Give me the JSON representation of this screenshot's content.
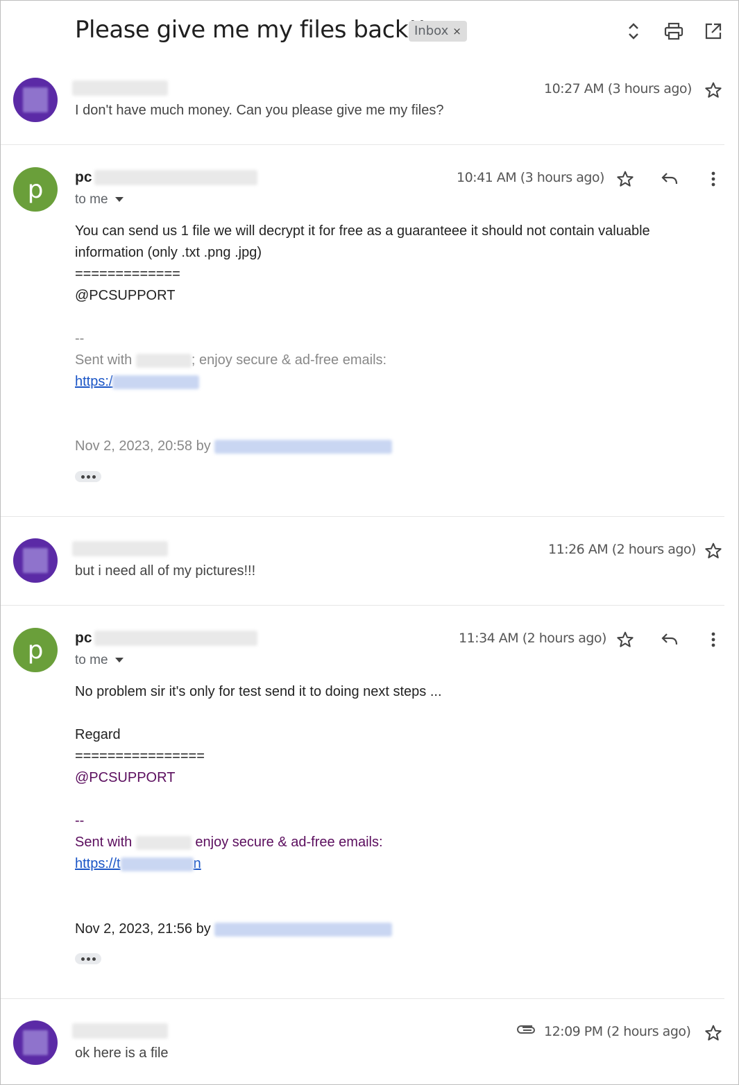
{
  "header": {
    "subject": "Please give me my files back!!",
    "label_badge": "Inbox",
    "label_close": "×"
  },
  "messages": [
    {
      "snippet": "I don't have much money. Can you please give me my files?",
      "time": "10:27 AM (3 hours ago)"
    },
    {
      "avatar_letter": "p",
      "sender_prefix": "pc",
      "recipient": "to me",
      "time": "10:41 AM (3 hours ago)",
      "body": [
        "You can send us 1 file we will decrypt it for free as a guaranteee it should not contain valuable",
        "information (only .txt .png .jpg)",
        "=============",
        "@PCSUPPORT"
      ],
      "sig_dash": "--",
      "sig_sent_with": "Sent with",
      "sig_rest": "; enjoy secure & ad-free emails:",
      "sig_link": "https:/",
      "quote_date": "Nov 2, 2023, 20:58 by"
    },
    {
      "snippet": "but i need all of my pictures!!!",
      "time": "11:26 AM (2 hours ago)"
    },
    {
      "avatar_letter": "p",
      "sender_prefix": "pc",
      "recipient": "to me",
      "time": "11:34 AM (2 hours ago)",
      "body": [
        "No problem sir it's only for test  send it to doing next steps ...",
        "Regard",
        "================",
        "@PCSUPPORT"
      ],
      "sig_dash": "--",
      "sig_sent_with": "Sent with",
      "sig_rest": " enjoy secure & ad-free emails:",
      "sig_link": "https://t",
      "sig_link_end": "n",
      "quote_date": "Nov 2, 2023, 21:56 by"
    },
    {
      "snippet": "ok here is a file",
      "time": "12:09 PM (2 hours ago)"
    }
  ],
  "colors": {
    "purple_avatar": "#5b2aa6",
    "green_avatar": "#6a9f3a",
    "link": "#1a55c6",
    "signature": "#5b0e5e"
  }
}
